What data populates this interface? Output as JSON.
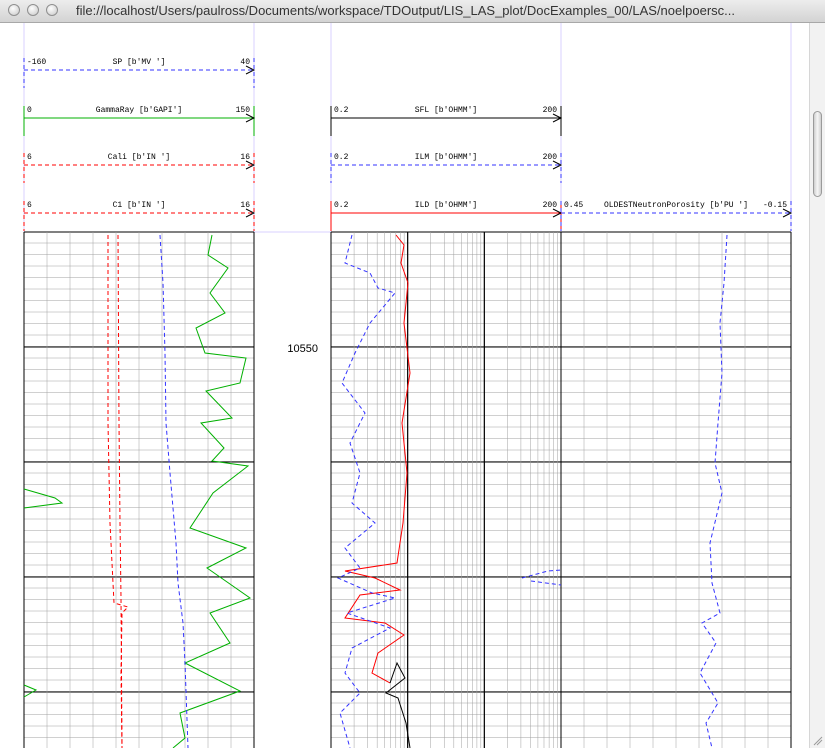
{
  "window": {
    "url": "file://localhost/Users/paulross/Documents/workspace/TDOutput/LIS_LAS_plot/DocExamples_00/LAS/noelpoersc..."
  },
  "depth_label": "10550",
  "colors": {
    "black": "#000000",
    "red": "#ff0000",
    "blue": "#3333ff",
    "green": "#00b000",
    "grid_fine": "#a0a0a0",
    "grid_major": "#000000"
  },
  "headers": [
    {
      "name": "SP [b'MV ']",
      "left": "-160",
      "right": "40",
      "color": "#3333ff",
      "dash": true
    },
    {
      "name": "GammaRay [b'GAPI']",
      "left": "0",
      "right": "150",
      "color": "#00b000",
      "dash": false
    },
    {
      "name": "Cali [b'IN ']",
      "left": "6",
      "right": "16",
      "color": "#ff0000",
      "dash": true
    },
    {
      "name": "C1 [b'IN ']",
      "left": "6",
      "right": "16",
      "color": "#ff0000",
      "dash": true
    },
    {
      "name": "SFL [b'OHMM']",
      "left": "0.2",
      "right": "200",
      "color": "#000000",
      "dash": false
    },
    {
      "name": "ILM [b'OHMM']",
      "left": "0.2",
      "right": "200",
      "color": "#3333ff",
      "dash": true
    },
    {
      "name": "ILD [b'OHMM']",
      "left": "0.2",
      "right": "200",
      "color": "#ff0000",
      "dash": false
    },
    {
      "name": "OLDESTNeutronPorosity [b'PU ']",
      "left": "0.45",
      "right": "-0.15",
      "color": "#3333ff",
      "dash": true
    }
  ],
  "icons": {
    "close": "close-button-icon",
    "minimize": "minimize-button-icon",
    "zoom": "zoom-button-icon"
  }
}
